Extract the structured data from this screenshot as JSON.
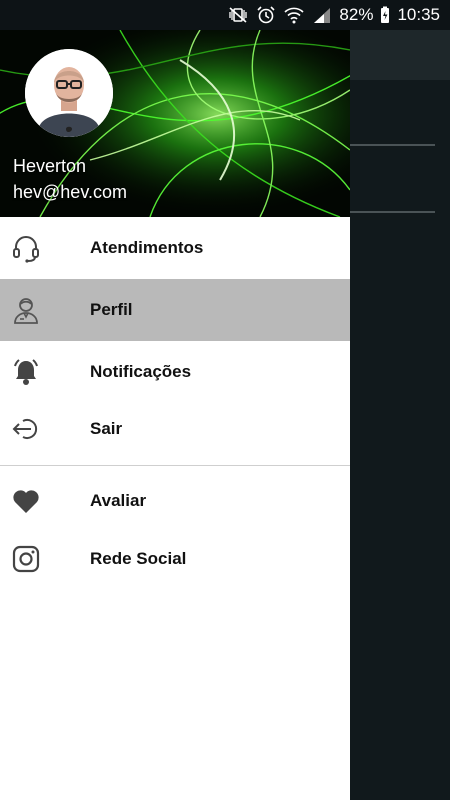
{
  "status_bar": {
    "battery_percent": "82%",
    "time": "10:35",
    "icons": [
      "mute-vibrate-icon",
      "alarm-icon",
      "wifi-icon",
      "signal-icon",
      "battery-charging-icon"
    ]
  },
  "drawer": {
    "header": {
      "user_name": "Heverton",
      "user_email": "hev@hev.com",
      "accent_color": "#39ff14"
    },
    "items": [
      {
        "label": "Atendimentos",
        "icon": "headset-icon",
        "active": false
      },
      {
        "label": "Perfil",
        "icon": "user-profile-icon",
        "active": true
      },
      {
        "label": "Notificações",
        "icon": "bell-icon",
        "active": false
      },
      {
        "label": "Sair",
        "icon": "logout-icon",
        "active": false
      }
    ],
    "secondary_items": [
      {
        "label": "Avaliar",
        "icon": "heart-icon"
      },
      {
        "label": "Rede Social",
        "icon": "instagram-icon"
      }
    ]
  },
  "colors": {
    "active_item_bg": "#b9b9b9",
    "scrim": "#11191c"
  }
}
